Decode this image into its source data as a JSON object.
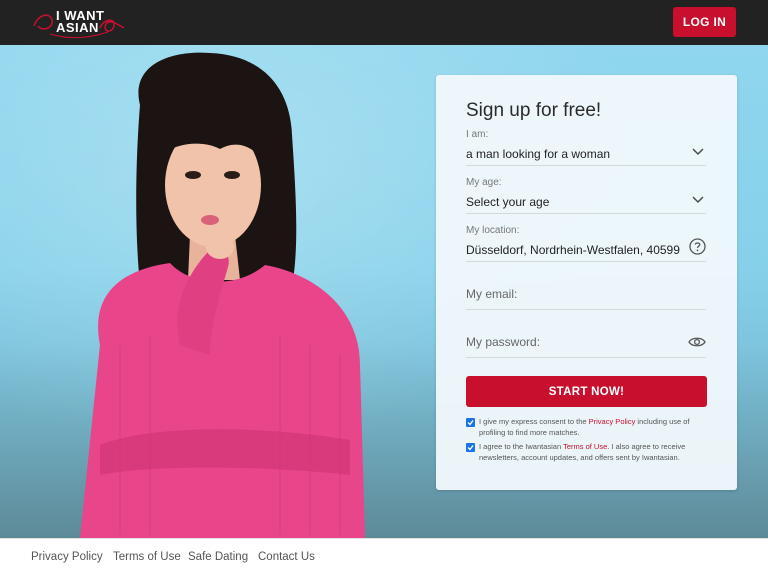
{
  "header": {
    "logo": {
      "line1": "I WANT",
      "line2": "ASIAN"
    },
    "login_label": "LOG IN"
  },
  "signup": {
    "title": "Sign up for free!",
    "iam": {
      "label": "I am:",
      "value": "a man looking for a woman"
    },
    "age": {
      "label": "My age:",
      "value": "Select your age"
    },
    "location": {
      "label": "My location:",
      "value": "Düsseldorf, Nordrhein-Westfalen, 40599"
    },
    "email": {
      "placeholder": "My email:"
    },
    "password": {
      "placeholder": "My password:"
    },
    "start_label": "START NOW!",
    "consent1": {
      "before": "I give my express consent to the ",
      "link": "Privacy Policy",
      "after": " including use of profiling to find more matches."
    },
    "consent2": {
      "before": "I agree to the Iwantasian ",
      "link": "Terms of Use",
      "after": ". I also agree to receive newsletters, account updates, and offers sent by Iwantasian."
    }
  },
  "footer": {
    "links": [
      "Privacy Policy",
      "Terms of Use",
      "Safe Dating",
      "Contact Us"
    ]
  },
  "colors": {
    "accent": "#c8102e",
    "topbar": "#222222",
    "checkbox": "#1a73e8"
  },
  "icons": [
    "chevron-down-icon",
    "question-circle-icon",
    "eye-icon",
    "checkmark-icon"
  ]
}
